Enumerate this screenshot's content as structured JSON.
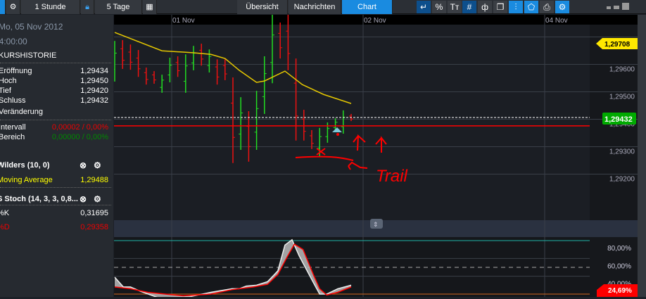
{
  "toolbar": {
    "interval": "1 Stunde",
    "range": "5 Tage",
    "tabs": [
      "Übersicht",
      "Nachrichten",
      "Chart"
    ],
    "active_tab": "Chart",
    "tool_icons": [
      "back-icon",
      "percent-icon",
      "text-size-icon",
      "grid-icon",
      "candle-icon",
      "windows-icon",
      "indicator-icon",
      "label-icon",
      "print-icon",
      "settings-icon"
    ]
  },
  "sidebar": {
    "date": "Mo, 05 Nov 2012",
    "time": "04:00:00",
    "section": "KURSHISTORIE",
    "ohlc": [
      {
        "label": "Eröffnung",
        "value": "1,29434"
      },
      {
        "label": "Hoch",
        "value": "1,29450"
      },
      {
        "label": "Tief",
        "value": "1,29420"
      },
      {
        "label": "Schluss",
        "value": "1,29432"
      }
    ],
    "change_label": "Veränderung",
    "intervall": {
      "label": "Intervall",
      "value": "0,00002 / 0,00%"
    },
    "bereich": {
      "label": "Bereich",
      "value": "0,00000 / 0,00%"
    },
    "indicator1": {
      "title": "Wilders (10, 0)",
      "line": "Moving Average",
      "value": "1,29488"
    },
    "indicator2": {
      "title": "S Stoch (14, 3, 3, 0,8...",
      "k_label": "%K",
      "k_value": "0,31695",
      "d_label": "%D",
      "d_value": "0,29358"
    }
  },
  "chart_data": {
    "type": "ohlc",
    "date_labels": [
      "01 Nov",
      "02 Nov",
      "04 Nov"
    ],
    "y_ticks": [
      "1,29700",
      "1,29600",
      "1,29500",
      "1,29400",
      "1,29300",
      "1,29200"
    ],
    "last_price": "1,29432",
    "ma_value_tag": "1,29708",
    "stop_line": 1.29404,
    "bars": [
      [
        1.29711,
        1.29563,
        "g"
      ],
      [
        1.29714,
        1.29609,
        "r"
      ],
      [
        1.29698,
        1.29606,
        "r"
      ],
      [
        1.29678,
        1.2958,
        "r"
      ],
      [
        1.29614,
        1.29552,
        "r"
      ],
      [
        1.29601,
        1.29555,
        "r"
      ],
      [
        1.29588,
        1.29522,
        "g"
      ],
      [
        1.2965,
        1.2956,
        "g"
      ],
      [
        1.29655,
        1.2958,
        "r"
      ],
      [
        1.29662,
        1.29522,
        "g"
      ],
      [
        1.29693,
        1.29604,
        "g"
      ],
      [
        1.29701,
        1.29621,
        "r"
      ],
      [
        1.2968,
        1.29596,
        "g"
      ],
      [
        1.29644,
        1.29552,
        "r"
      ],
      [
        1.29644,
        1.29568,
        "r"
      ],
      [
        1.29578,
        1.29266,
        "r"
      ],
      [
        1.29506,
        1.29314,
        "g"
      ],
      [
        1.29455,
        1.29271,
        "r"
      ],
      [
        1.29529,
        1.29314,
        "g"
      ],
      [
        1.29655,
        1.29445,
        "g"
      ],
      [
        1.29808,
        1.29557,
        "g"
      ],
      [
        1.29778,
        1.29647,
        "r"
      ],
      [
        1.29808,
        1.29604,
        "r"
      ],
      [
        1.29647,
        1.29348,
        "r"
      ],
      [
        1.2946,
        1.29348,
        "r"
      ],
      [
        1.29386,
        1.29317,
        "r"
      ],
      [
        1.29394,
        1.29289,
        "g"
      ],
      [
        1.29414,
        1.2934,
        "g"
      ],
      [
        1.29429,
        1.29381,
        "g"
      ],
      [
        1.29458,
        1.29373,
        "g"
      ],
      [
        1.29445,
        1.29419,
        "r"
      ]
    ],
    "moving_average": [
      [
        0,
        1.29742
      ],
      [
        6,
        1.29675
      ],
      [
        10,
        1.29668
      ],
      [
        12.2,
        1.29662
      ],
      [
        14,
        1.29647
      ],
      [
        15.8,
        1.29604
      ],
      [
        18,
        1.2956
      ],
      [
        19,
        1.29565
      ],
      [
        21.6,
        1.29601
      ],
      [
        23.8,
        1.29552
      ],
      [
        26.5,
        1.29516
      ],
      [
        30,
        1.29483
      ]
    ],
    "stoch_ticks": [
      "80,00%",
      "60,00%",
      "40,00%"
    ],
    "stoch_last": "24,69%",
    "stoch_k": [
      [
        0,
        39
      ],
      [
        1.1,
        28
      ],
      [
        2,
        28
      ],
      [
        3.3,
        23
      ],
      [
        5.5,
        16
      ],
      [
        9.5,
        17
      ],
      [
        12.2,
        22
      ],
      [
        14.9,
        26
      ],
      [
        15.8,
        26
      ],
      [
        16.7,
        29
      ],
      [
        18,
        30
      ],
      [
        19.4,
        34
      ],
      [
        20.7,
        46
      ],
      [
        21.6,
        75
      ],
      [
        22.5,
        81
      ],
      [
        23.4,
        63
      ],
      [
        25.2,
        33
      ],
      [
        26,
        20
      ],
      [
        26.9,
        20
      ],
      [
        28.3,
        26
      ],
      [
        30,
        30
      ]
    ],
    "stoch_d": [
      [
        0,
        28
      ],
      [
        2,
        26
      ],
      [
        4.2,
        22
      ],
      [
        8.7,
        18
      ],
      [
        12.2,
        20
      ],
      [
        14.9,
        25
      ],
      [
        17.6,
        28
      ],
      [
        19.4,
        31
      ],
      [
        20.7,
        42
      ],
      [
        21.9,
        62
      ],
      [
        22.8,
        76
      ],
      [
        23.9,
        70
      ],
      [
        25.2,
        42
      ],
      [
        26,
        26
      ],
      [
        26.9,
        19
      ],
      [
        28.3,
        22
      ],
      [
        30,
        28
      ]
    ]
  },
  "annotation": "Trail"
}
